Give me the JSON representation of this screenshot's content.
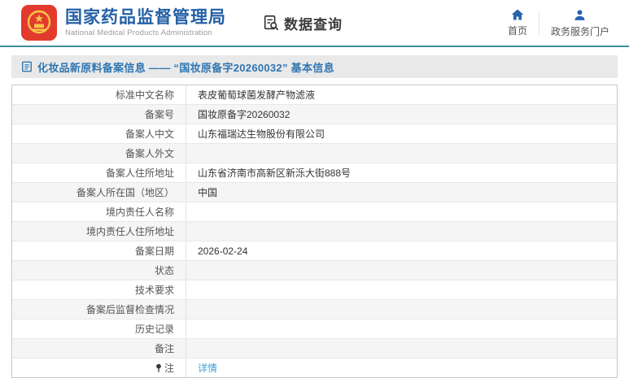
{
  "header": {
    "org_name_zh": "国家药品监督管理局",
    "org_name_en": "National Medical Products Administration",
    "query": {
      "label": "数据查询",
      "icon": "document-search-icon"
    },
    "nav": [
      {
        "label": "首页",
        "icon": "home-icon"
      },
      {
        "label": "政务服务门户",
        "icon": "user-icon"
      }
    ]
  },
  "page": {
    "title_icon": "document-icon",
    "title": "化妆品新原料备案信息 —— “国妆原备字20260032” 基本信息"
  },
  "table": {
    "rows": [
      {
        "label": "标准中文名称",
        "value": "表皮葡萄球菌发酵产物滤液"
      },
      {
        "label": "备案号",
        "value": "国妆原备字20260032"
      },
      {
        "label": "备案人中文",
        "value": "山东福瑞达生物股份有限公司"
      },
      {
        "label": "备案人外文",
        "value": ""
      },
      {
        "label": "备案人住所地址",
        "value": "山东省济南市高新区新泺大街888号"
      },
      {
        "label": "备案人所在国（地区）",
        "value": "中国"
      },
      {
        "label": "境内责任人名称",
        "value": ""
      },
      {
        "label": "境内责任人住所地址",
        "value": ""
      },
      {
        "label": "备案日期",
        "value": "2026-02-24"
      },
      {
        "label": "状态",
        "value": ""
      },
      {
        "label": "技术要求",
        "value": ""
      },
      {
        "label": "备案后监督检查情况",
        "value": ""
      },
      {
        "label": "历史记录",
        "value": ""
      },
      {
        "label": "备注",
        "value": ""
      },
      {
        "label": "注",
        "label_icon": "pin-icon",
        "value": "详情",
        "link": true
      }
    ]
  },
  "colors": {
    "brand_blue": "#2360a5",
    "logo_red": "#e23b2e",
    "emblem_gold": "#f7c64a",
    "header_rule_teal": "#3f8fa0",
    "title_bar_bg": "#e9e9e9",
    "title_text_blue": "#3076b1",
    "link_blue": "#3b9dd8",
    "row_stripe": "#f5f5f5"
  }
}
